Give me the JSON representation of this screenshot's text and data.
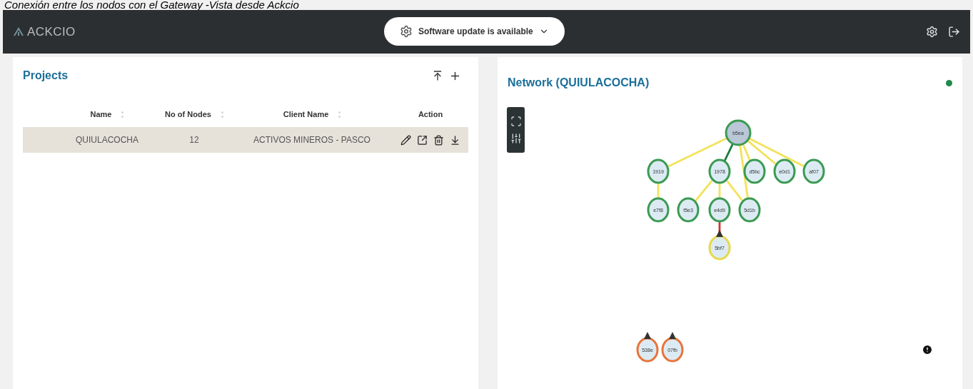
{
  "caption": "Conexión entre los nodos con el Gateway -Vista desde Ackcio",
  "header": {
    "logo": "ACKCIO",
    "update_button": "Software update is available"
  },
  "projects": {
    "title": "Projects",
    "columns": [
      {
        "label": "Name",
        "sortable": true
      },
      {
        "label": "No of Nodes",
        "sortable": true
      },
      {
        "label": "Client Name",
        "sortable": true
      },
      {
        "label": "Action",
        "sortable": false
      }
    ],
    "rows": [
      {
        "cells": [
          "QUIULACOCHA",
          "12",
          "ACTIVOS MINEROS - PASCO"
        ],
        "selected": true
      }
    ]
  },
  "network": {
    "title": "Network (QUIULACOCHA)",
    "status": {
      "color": "#1f8a4c"
    },
    "nodes": [
      {
        "label": "b5ea",
        "kind": "gateway",
        "color": "#3a9a52",
        "alert": false
      },
      {
        "label": "1919",
        "kind": "node",
        "color": "#3a9a52",
        "alert": false,
        "link": {
          "color": "#f3e25a"
        }
      },
      {
        "label": "1978",
        "kind": "node",
        "color": "#3a9a52",
        "alert": false,
        "link": {
          "color": "#1f7a3a"
        }
      },
      {
        "label": "d5bc",
        "kind": "node",
        "color": "#3a9a52",
        "alert": false,
        "link": {
          "color": "#f3e25a"
        }
      },
      {
        "label": "e0d1",
        "kind": "node",
        "color": "#3a9a52",
        "alert": false,
        "link": {
          "color": "#f3e25a"
        }
      },
      {
        "label": "af07",
        "kind": "node",
        "color": "#3a9a52",
        "alert": false,
        "link": {
          "color": "#f3e25a"
        }
      },
      {
        "label": "e7f8",
        "kind": "node",
        "color": "#3a9a52",
        "alert": false,
        "link": {
          "color": "#f3e25a"
        }
      },
      {
        "label": "f5e3",
        "kind": "node",
        "color": "#3a9a52",
        "alert": false,
        "link": {
          "color": "#f3e25a"
        }
      },
      {
        "label": "e4d9",
        "kind": "node",
        "color": "#3a9a52",
        "alert": false,
        "link": {
          "color": "#f3e25a"
        }
      },
      {
        "label": "5d1b",
        "kind": "node",
        "color": "#3a9a52",
        "alert": false,
        "link": {
          "color": "#f3e25a"
        }
      },
      {
        "label": "5bf7",
        "kind": "node",
        "color": "#e8d84a",
        "alert": true,
        "link": {
          "color": "#d0352b"
        }
      },
      {
        "label": "538e",
        "kind": "node",
        "color": "#e8743b",
        "alert": true
      },
      {
        "label": "07fb",
        "kind": "node",
        "color": "#e8743b",
        "alert": true
      }
    ]
  }
}
